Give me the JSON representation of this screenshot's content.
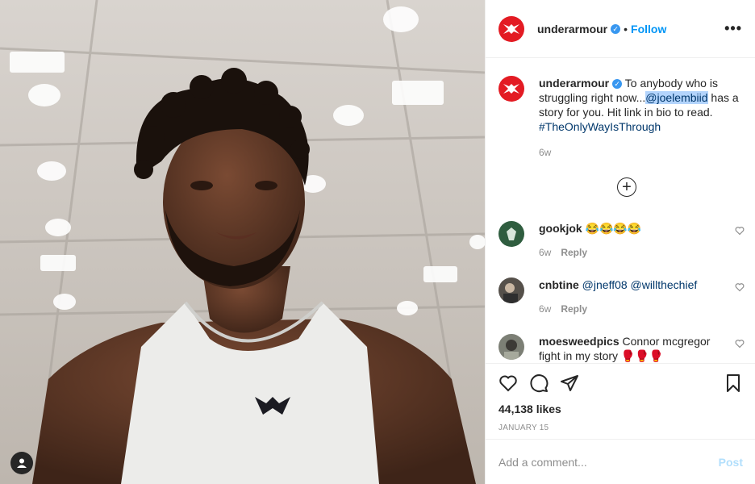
{
  "header": {
    "username": "underarmour",
    "follow_label": "Follow",
    "more_label": "•••"
  },
  "caption": {
    "username": "underarmour",
    "text_before": "To anybody who is struggling right now...",
    "mention": "@joelembiid",
    "text_after": " has a story for you. Hit link in bio to read.",
    "hashtag": "#TheOnlyWayIsThrough",
    "time": "6w"
  },
  "comments": [
    {
      "username": "gookjok",
      "text": "😂😂😂😂",
      "time": "6w",
      "reply": "Reply"
    },
    {
      "username": "cnbtine",
      "text": "@jneff08 @willthechief",
      "time": "6w",
      "reply": "Reply"
    },
    {
      "username": "moesweedpics",
      "text": "Connor mcgregor fight in my story 🥊🥊🥊"
    }
  ],
  "likes": "44,138 likes",
  "date": "JANUARY 15",
  "add_comment": {
    "placeholder": "Add a comment...",
    "post_label": "Post"
  },
  "colors": {
    "brand_red": "#e31b23",
    "link_blue": "#0095f6",
    "verified": "#3897f0"
  }
}
